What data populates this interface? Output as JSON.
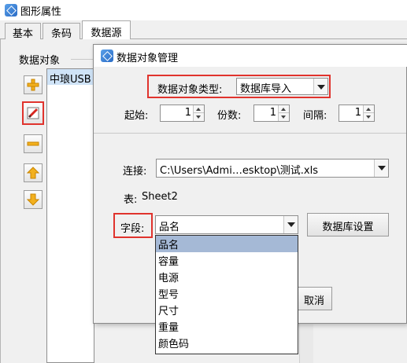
{
  "back_window": {
    "title": "图形属性",
    "tabs": [
      "基本",
      "条码",
      "数据源"
    ],
    "active_tab": "数据源",
    "group_label": "数据对象",
    "list_items": [
      "中琅USB"
    ],
    "side_buttons": [
      "plus-icon",
      "edit-icon",
      "minus-icon",
      "arrow-up-icon",
      "arrow-down-icon"
    ]
  },
  "dialog": {
    "title": "数据对象管理",
    "type_label": "数据对象类型:",
    "type_value": "数据库导入",
    "start_label": "起始:",
    "start_value": "1",
    "copies_label": "份数:",
    "copies_value": "1",
    "interval_label": "间隔:",
    "interval_value": "1",
    "connection_label": "连接:",
    "connection_value": "C:\\Users\\Admi…esktop\\测试.xls",
    "table_label": "表:",
    "table_value": "Sheet2",
    "field_label": "字段:",
    "field_value": "品名",
    "db_settings_button": "数据库设置",
    "cancel_button": "取消",
    "field_options": [
      "品名",
      "容量",
      "电源",
      "型号",
      "尺寸",
      "重量",
      "颜色码"
    ],
    "selected_option": "品名"
  },
  "colors": {
    "highlight_red": "#e0332d",
    "selection_blue": "#a5b9d6",
    "list_selection": "#cfe3f7",
    "window_bg": "#f0f0f0"
  }
}
